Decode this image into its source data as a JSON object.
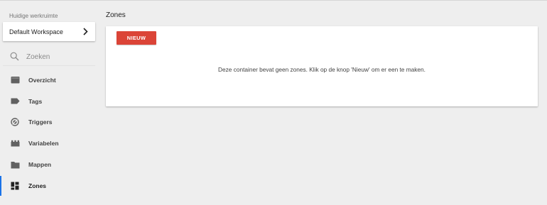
{
  "sidebar": {
    "workspace_label": "Huidige werkruimte",
    "workspace_name": "Default Workspace",
    "search": {
      "placeholder": "Zoeken",
      "value": ""
    },
    "items": [
      {
        "label": "Overzicht",
        "icon": "folder-overview-icon"
      },
      {
        "label": "Tags",
        "icon": "tag-icon"
      },
      {
        "label": "Triggers",
        "icon": "trigger-icon"
      },
      {
        "label": "Variabelen",
        "icon": "variable-icon"
      },
      {
        "label": "Mappen",
        "icon": "folder-icon"
      },
      {
        "label": "Zones",
        "icon": "zones-icon",
        "active": true
      }
    ]
  },
  "main": {
    "title": "Zones",
    "new_button_label": "NIEUW",
    "empty_message": "Deze container bevat geen zones. Klik op de knop 'Nieuw' om er een te maken."
  },
  "colors": {
    "accent_button": "#db4437",
    "active_indicator": "#1a73e8",
    "background": "#eeeeee",
    "icon": "#616161"
  }
}
